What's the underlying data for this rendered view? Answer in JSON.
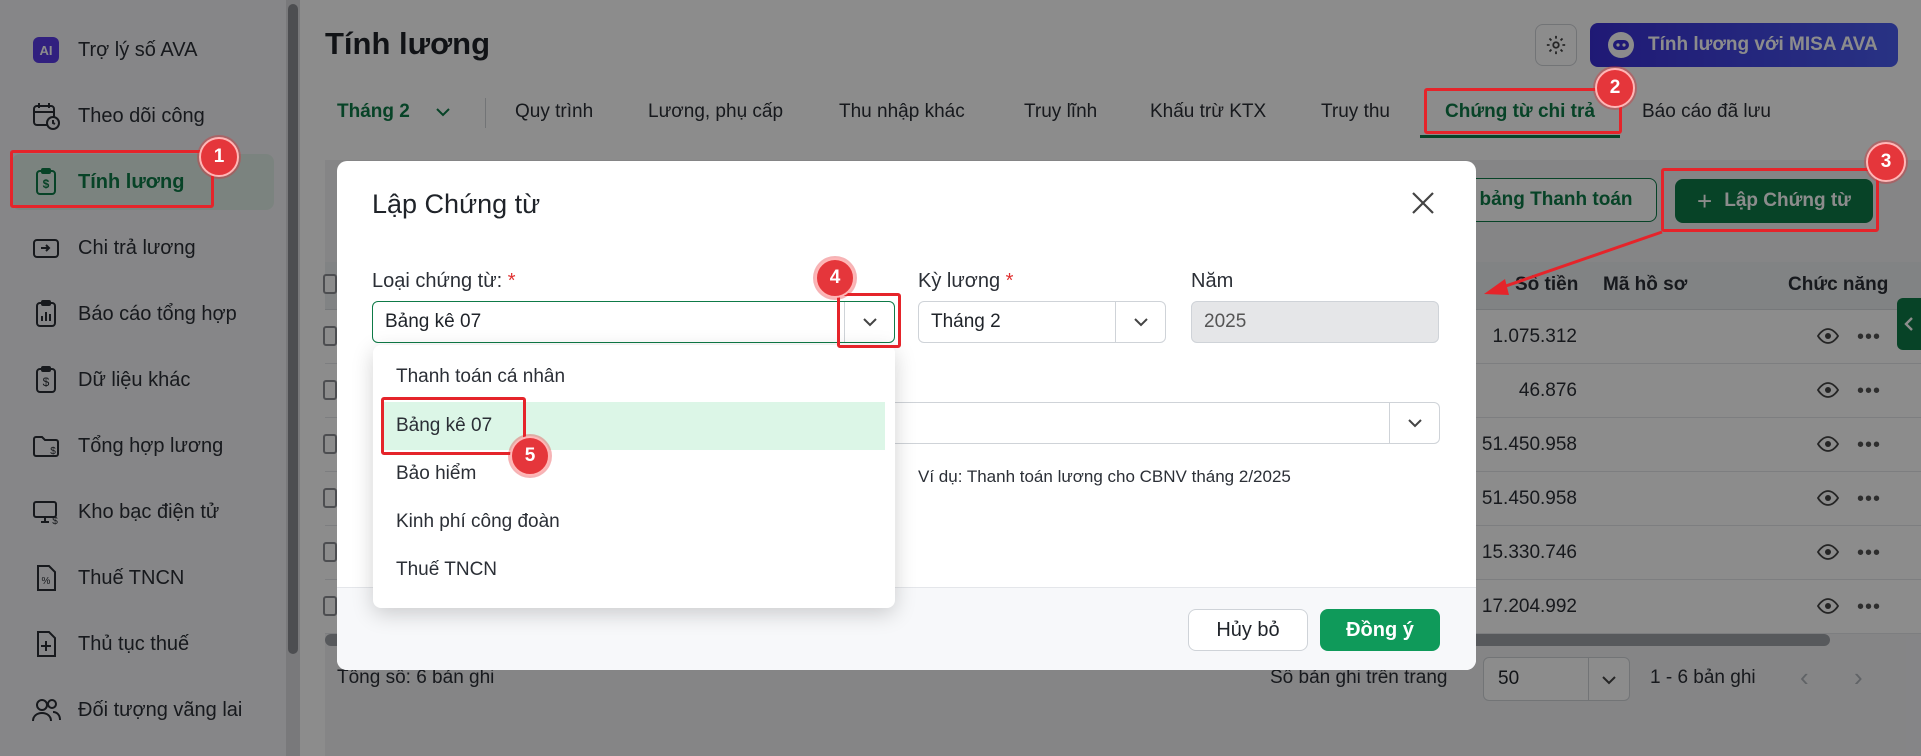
{
  "sidebar": {
    "items": [
      {
        "label": "Trợ lý số AVA",
        "icon": "ai-icon"
      },
      {
        "label": "Theo dõi công",
        "icon": "calendar-clock-icon"
      },
      {
        "label": "Tính lương",
        "icon": "salary-clipboard-icon",
        "active": true
      },
      {
        "label": "Chi trả lương",
        "icon": "wallet-icon"
      },
      {
        "label": "Báo cáo tổng hợp",
        "icon": "report-chart-icon"
      },
      {
        "label": "Dữ liệu khác",
        "icon": "data-clipboard-icon"
      },
      {
        "label": "Tổng hợp lương",
        "icon": "folder-money-icon"
      },
      {
        "label": "Kho bạc điện tử",
        "icon": "monitor-money-icon"
      },
      {
        "label": "Thuế TNCN",
        "icon": "tax-document-icon"
      },
      {
        "label": "Thủ tục thuế",
        "icon": "document-plus-icon"
      },
      {
        "label": "Đối tượng vãng lai",
        "icon": "users-icon"
      }
    ]
  },
  "header": {
    "title": "Tính lương",
    "ava_button": "Tính lương với MISA AVA"
  },
  "tabs": {
    "month": "Tháng 2",
    "items": [
      "Quy trình",
      "Lương, phụ cấp",
      "Thu nhập khác",
      "Truy lĩnh",
      "Khấu trừ KTX",
      "Truy thu",
      "Chứng từ chi trả",
      "Báo cáo đã lưu"
    ],
    "active": "Chứng từ chi trả"
  },
  "toolbar": {
    "payment_button": "bảng Thanh toán",
    "create_button": "Lập Chứng từ"
  },
  "table": {
    "headers": {
      "amount": "Số tiền",
      "record": "Mã hồ sơ",
      "actions": "Chức năng"
    },
    "rows": [
      {
        "amount": "1.075.312"
      },
      {
        "amount": "46.876"
      },
      {
        "amount": "51.450.958"
      },
      {
        "amount": "51.450.958"
      },
      {
        "amount": "15.330.746"
      },
      {
        "amount": "17.204.992"
      }
    ]
  },
  "footer": {
    "total": "Tổng số: 6 bản ghi",
    "per_page_label": "Số bản ghi trên trang",
    "per_page_value": "50",
    "range": "1 - 6 bản ghi"
  },
  "modal": {
    "title": "Lập Chứng từ",
    "voucher_type_label": "Loại chứng từ:",
    "voucher_type_value": "Bảng kê 07",
    "period_label": "Kỳ lương",
    "period_value": "Tháng 2",
    "year_label": "Năm",
    "year_value": "2025",
    "hint": "Ví dụ: Thanh toán lương cho CBNV tháng 2/2025",
    "required_mark": "*",
    "cancel": "Hủy bỏ",
    "ok": "Đồng ý"
  },
  "dropdown": {
    "options": [
      "Thanh toán cá nhân",
      "Bảng kê 07",
      "Bảo hiểm",
      "Kinh phí công đoàn",
      "Thuế TNCN"
    ],
    "selected": "Bảng kê 07"
  },
  "annotations": {
    "steps": [
      "1",
      "2",
      "3",
      "4",
      "5"
    ],
    "color": "#e5242a"
  },
  "colors": {
    "brand_green": "#0e7a47",
    "ava_blue": "#3a2fd6"
  }
}
